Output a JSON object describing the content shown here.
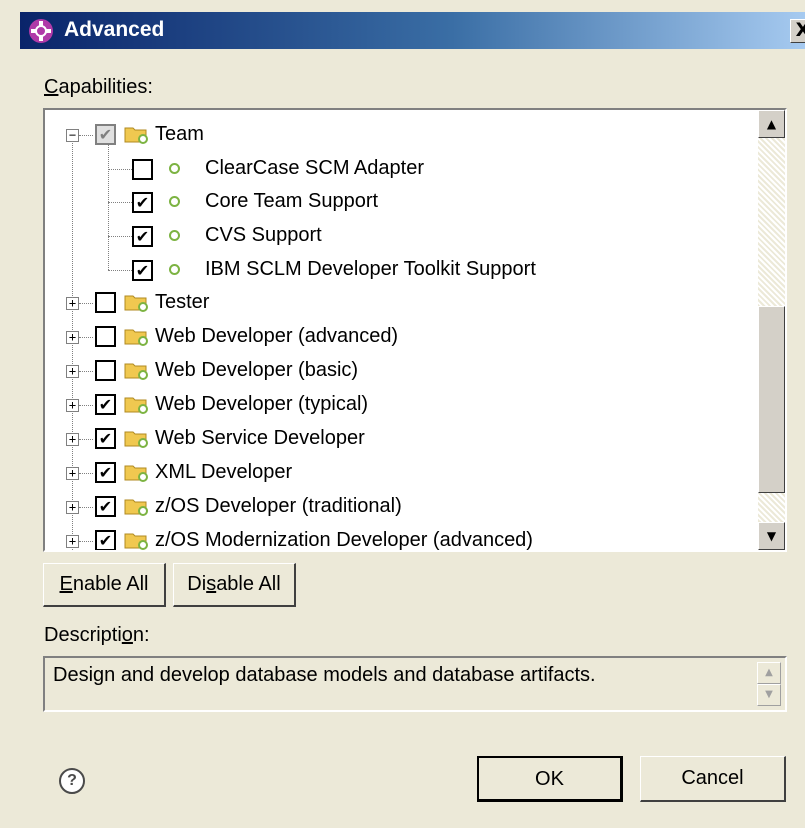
{
  "window": {
    "title": "Advanced",
    "close_label": "X",
    "icon": "eclipse-capabilities-icon"
  },
  "capabilities": {
    "label_prefix": "C",
    "label_rest": "apabilities:"
  },
  "tree": {
    "team": {
      "label": "Team",
      "checked": "partial",
      "expanded": true
    },
    "team_children": [
      {
        "label": "ClearCase SCM Adapter",
        "checked": false
      },
      {
        "label": "Core Team Support",
        "checked": true
      },
      {
        "label": "CVS Support",
        "checked": true
      },
      {
        "label": "IBM SCLM Developer Toolkit Support",
        "checked": true
      }
    ],
    "groups": [
      {
        "label": "Tester",
        "checked": false
      },
      {
        "label": "Web Developer (advanced)",
        "checked": false
      },
      {
        "label": "Web Developer (basic)",
        "checked": false
      },
      {
        "label": "Web Developer (typical)",
        "checked": true
      },
      {
        "label": "Web Service Developer",
        "checked": true
      },
      {
        "label": "XML Developer",
        "checked": true
      },
      {
        "label": "z/OS Developer (traditional)",
        "checked": true
      },
      {
        "label": "z/OS Modernization Developer (advanced)",
        "checked": true
      }
    ],
    "check_glyph": "✔"
  },
  "buttons": {
    "enable_all_u": "E",
    "enable_all_rest": "nable All",
    "disable_all_a": "Di",
    "disable_all_u": "s",
    "disable_all_b": "able All",
    "ok": "OK",
    "cancel": "Cancel"
  },
  "description": {
    "label_a": "Descripti",
    "label_u": "o",
    "label_b": "n:",
    "text": "Design and develop database models and database artifacts."
  },
  "help": {
    "glyph": "?"
  },
  "colors": {
    "title_start": "#0a246a",
    "title_end": "#a6caf0",
    "dialog_bg": "#ece9d8",
    "folder": "#f0c850",
    "plugin_dot": "#7cb342"
  }
}
